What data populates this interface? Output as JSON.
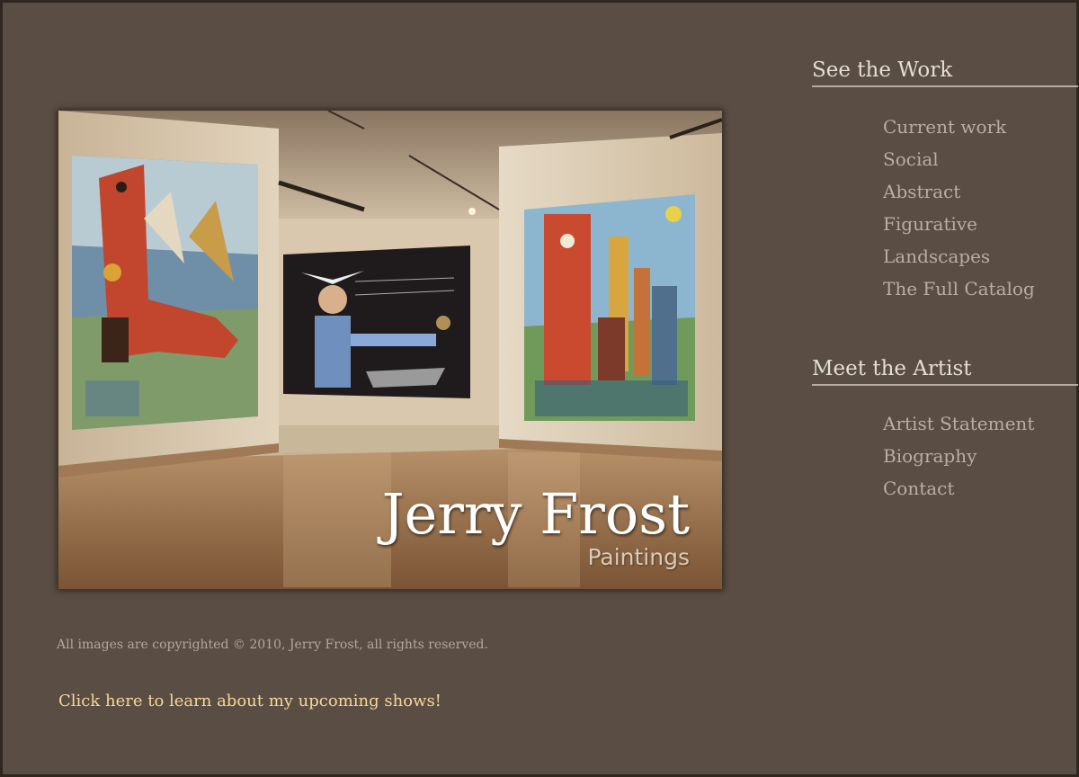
{
  "hero": {
    "title": "Jerry Frost",
    "subtitle": "Paintings"
  },
  "nav": {
    "work": {
      "heading": "See the Work",
      "items": [
        "Current work",
        "Social",
        "Abstract",
        "Figurative",
        "Landscapes",
        "The Full Catalog"
      ]
    },
    "artist": {
      "heading": "Meet the Artist",
      "items": [
        "Artist Statement",
        "Biography",
        "Contact"
      ]
    }
  },
  "footer": {
    "copyright": "All images are copyrighted © 2010, Jerry Frost, all rights reserved.",
    "shows_link": "Click here to learn about my upcoming shows!"
  },
  "colors": {
    "background": "#5a4d43",
    "heading": "#e4ddd5",
    "link": "#b8aea4",
    "highlight_link": "#f5d79a"
  }
}
